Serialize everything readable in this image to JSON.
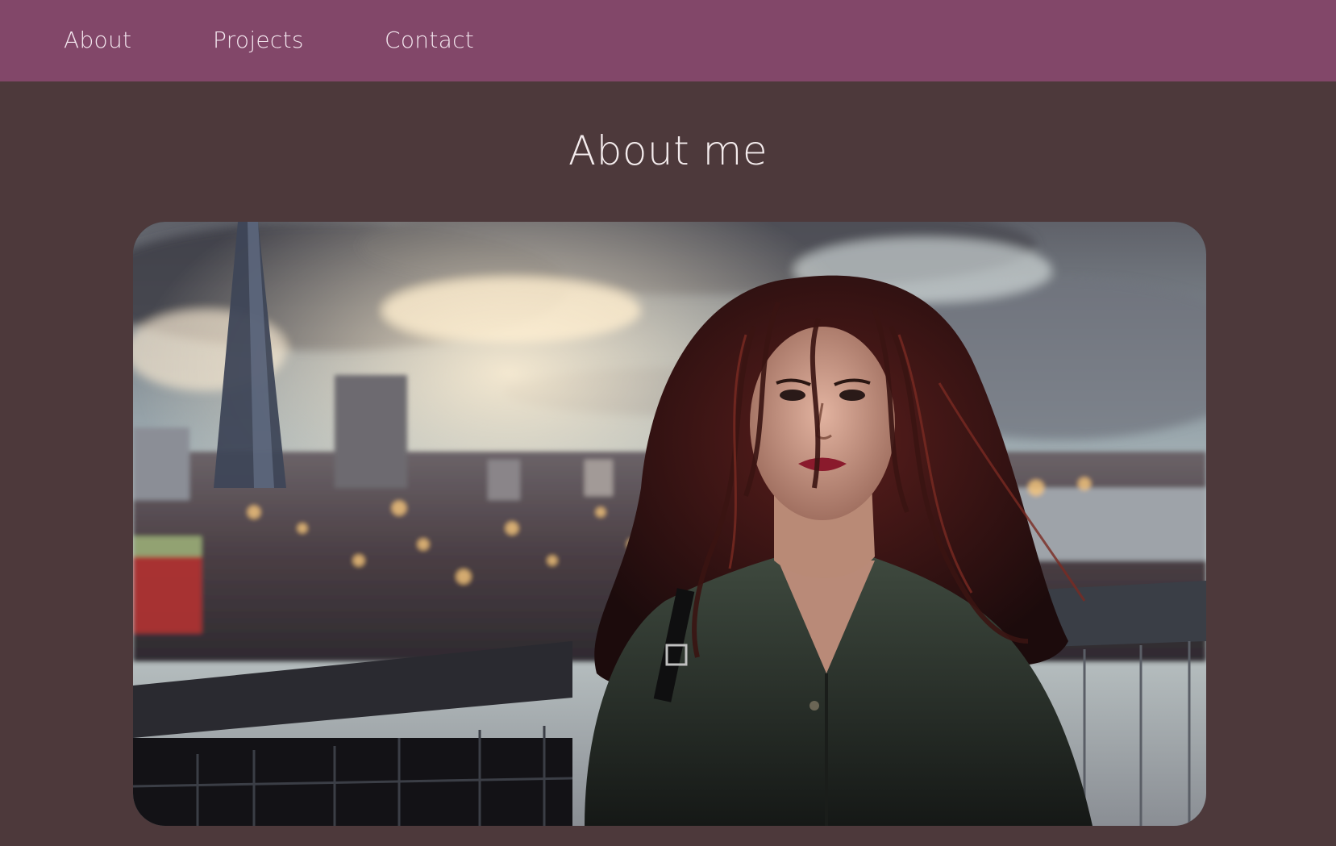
{
  "nav": {
    "items": [
      {
        "label": "About"
      },
      {
        "label": "Projects"
      },
      {
        "label": "Contact"
      }
    ]
  },
  "main": {
    "title": "About me"
  },
  "colors": {
    "navbar_bg": "#824769",
    "page_bg": "#4d393b",
    "text": "#f4eced"
  }
}
